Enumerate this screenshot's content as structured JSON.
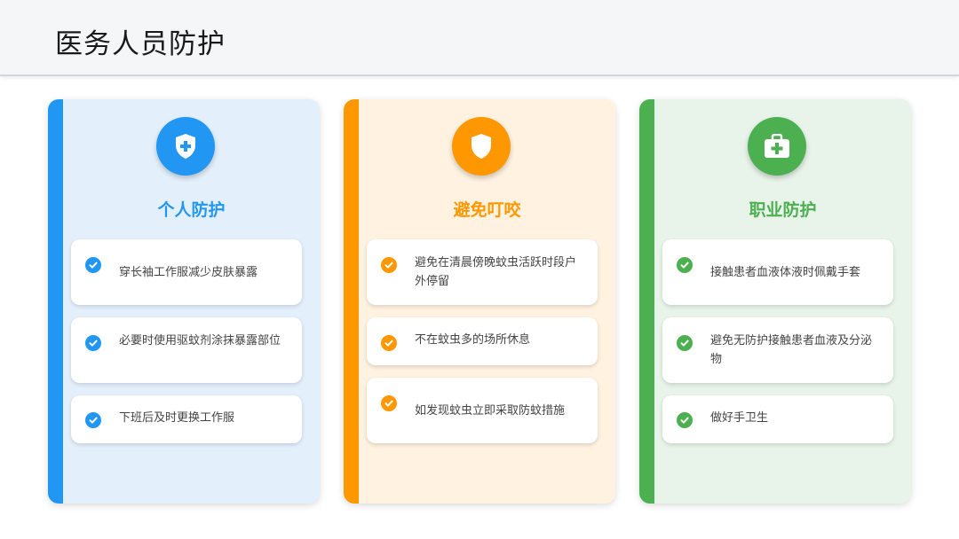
{
  "page": {
    "title": "医务人员防护"
  },
  "cards": [
    {
      "title": "个人防护",
      "icon": "shield-plus-icon",
      "accent": "#2196f3",
      "items": [
        "穿长袖工作服减少皮肤暴露",
        "必要时使用驱蚊剂涂抹暴露部位",
        "下班后及时更换工作服"
      ]
    },
    {
      "title": "避免叮咬",
      "icon": "shield-icon",
      "accent": "#ff9800",
      "items": [
        "避免在清晨傍晚蚊虫活跃时段户外停留",
        "不在蚊虫多的场所休息",
        "如发现蚊虫立即采取防蚊措施"
      ]
    },
    {
      "title": "职业防护",
      "icon": "medical-kit-icon",
      "accent": "#4caf50",
      "items": [
        "接触患者血液体液时佩戴手套",
        "避免无防护接触患者血液及分泌物",
        "做好手卫生"
      ]
    }
  ]
}
